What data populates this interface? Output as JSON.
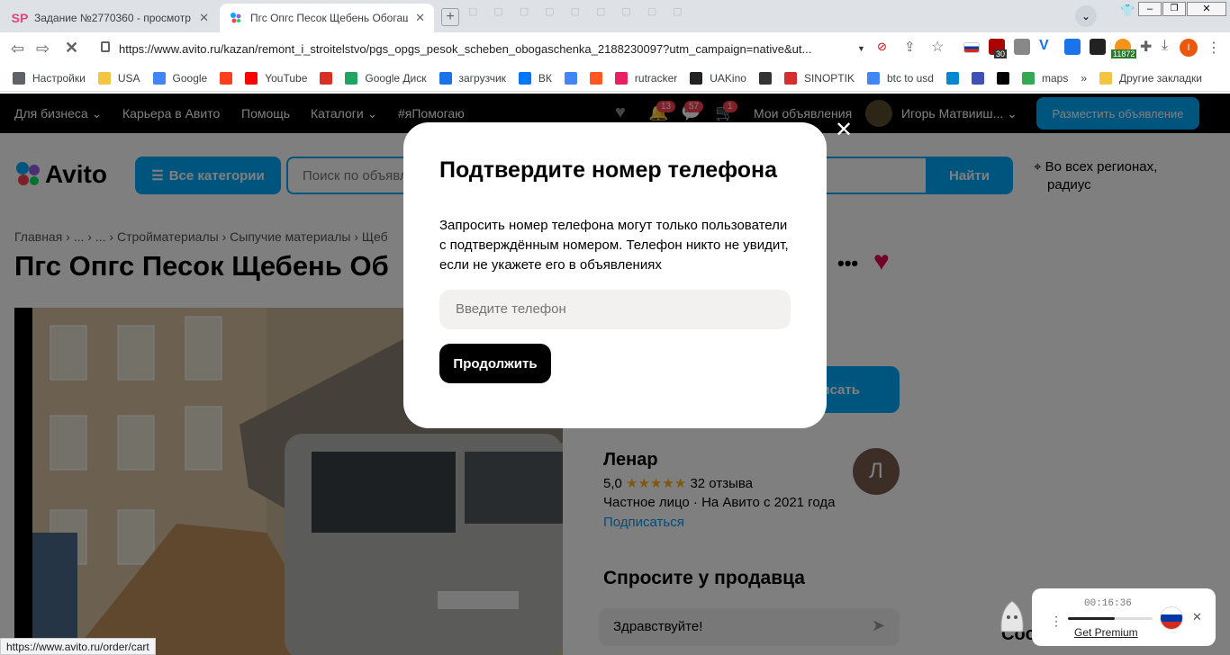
{
  "browser": {
    "tabs": [
      {
        "favicon": "SP",
        "title": "Задание №2770360 - просмотр з",
        "active": false
      },
      {
        "favicon": "avito-dots",
        "title": "Пгс Опгс Песок Щебень Обогащ",
        "active": true
      }
    ],
    "new_tab_icon": "plus-icon",
    "url": "https://www.avito.ru/kazan/remont_i_stroitelstvo/pgs_opgs_pesok_scheben_obogaschenka_2188230097?utm_campaign=native&ut...",
    "bookmarks": [
      {
        "label": "Настройки",
        "icon": "gear-icon"
      },
      {
        "label": "USA",
        "icon": "folder-icon"
      },
      {
        "label": "Google",
        "icon": "google-icon"
      },
      {
        "label": "",
        "icon": "yandex-icon"
      },
      {
        "label": "YouTube",
        "icon": "youtube-icon"
      },
      {
        "label": "",
        "icon": "gmail-icon"
      },
      {
        "label": "Google Диск",
        "icon": "drive-icon"
      },
      {
        "label": "загрузчик",
        "icon": "infinity-icon"
      },
      {
        "label": "ВК",
        "icon": "vk-icon"
      },
      {
        "label": "",
        "icon": "translate-icon"
      },
      {
        "label": "",
        "icon": "f-icon"
      },
      {
        "label": "rutracker",
        "icon": "rutracker-icon"
      },
      {
        "label": "UAKino",
        "icon": "uakino-icon"
      },
      {
        "label": "",
        "icon": "chess-icon"
      },
      {
        "label": "SINOPTIK",
        "icon": "thermometer-icon"
      },
      {
        "label": "btc to usd",
        "icon": "google-icon"
      },
      {
        "label": "",
        "icon": "p-icon"
      },
      {
        "label": "",
        "icon": "arrow-icon"
      },
      {
        "label": "",
        "icon": "bc-icon"
      },
      {
        "label": "maps",
        "icon": "maps-icon"
      }
    ],
    "bookmarks_more": "»",
    "other_bookmarks": "Другие закладки",
    "extension_badges": {
      "calendar": "30",
      "btc": "11872"
    },
    "profile_initial": "I",
    "status_url": "https://www.avito.ru/order/cart"
  },
  "avito": {
    "nav": {
      "business": "Для бизнеса",
      "career": "Карьера в Авито",
      "help": "Помощь",
      "catalogs": "Каталоги",
      "help_tag": "#яПомогаю",
      "badges": {
        "notifications": "13",
        "messages": "57",
        "cart": "1"
      },
      "my_ads": "Мои объявления",
      "user_name": "Игорь Матвииш...",
      "post_ad": "Разместить объявление"
    },
    "logo": "Avito",
    "all_categories": "Все категории",
    "search_placeholder": "Поиск по объявлениям",
    "search_button": "Найти",
    "region_line1": "Во всех регионах,",
    "region_line2": "радиус",
    "breadcrumb": [
      "Главная",
      "...",
      "...",
      "Стройматериалы",
      "Сыпучие материалы",
      "Щеб"
    ],
    "title": "Пгс Опгс Песок Щебень Об",
    "write_button": "исать",
    "seller": {
      "name": "Ленар",
      "avatar_initial": "Л",
      "rating": "5,0",
      "stars": 5,
      "reviews": "32 отзыва",
      "type": "Частное лицо · На Авито с 2021 года",
      "subscribe": "Подписаться"
    },
    "ask_seller": "Спросите у продавца",
    "message_placeholder": "Здравствуйте!",
    "bottom_cut": "Coo"
  },
  "modal": {
    "title": "Подтвердите номер телефона",
    "body": "Запросить номер телефона могут только пользователи с подтверждённым номером. Телефон никто не увидит, если не укажете его в объявлениях",
    "phone_placeholder": "Введите телефон",
    "continue": "Продолжить"
  },
  "vpn_widget": {
    "timer": "00:16:36",
    "progress": 0.55,
    "premium": "Get Premium"
  },
  "colors": {
    "accent": "#00aaff",
    "heart": "#e30051",
    "dark": "#000000",
    "star": "#ffb021"
  }
}
